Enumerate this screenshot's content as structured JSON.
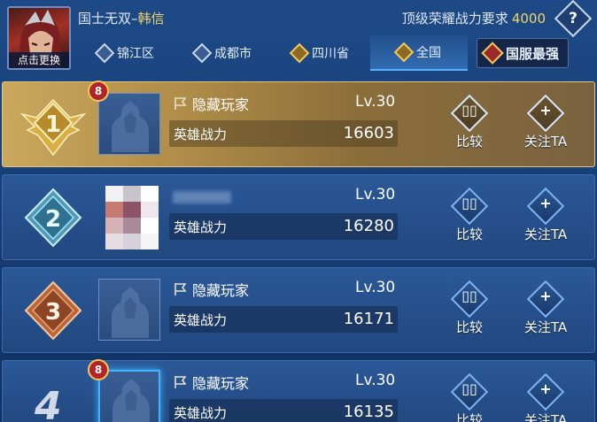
{
  "header": {
    "avatar_caption": "点击更换",
    "hero_title": "国士无双–",
    "hero_name": "韩信",
    "requirement_label": "顶级荣耀战力要求",
    "requirement_value": "4000",
    "help_label": "?"
  },
  "tabs": [
    {
      "label": "锦江区",
      "icon": "district-badge-icon"
    },
    {
      "label": "成都市",
      "icon": "city-badge-icon"
    },
    {
      "label": "四川省",
      "icon": "province-badge-icon"
    },
    {
      "label": "全国",
      "icon": "national-badge-icon",
      "active": true
    },
    {
      "label": "国服最强",
      "icon": "national-strongest-icon"
    }
  ],
  "rows": [
    {
      "rank": "1",
      "name": "隐藏玩家",
      "level": "Lv.30",
      "power_label": "英雄战力",
      "power": "16603",
      "badge_level": "8"
    },
    {
      "rank": "2",
      "name": "",
      "level": "Lv.30",
      "power_label": "英雄战力",
      "power": "16280"
    },
    {
      "rank": "3",
      "name": "隐藏玩家",
      "level": "Lv.30",
      "power_label": "英雄战力",
      "power": "16171"
    },
    {
      "rank": "4",
      "name": "隐藏玩家",
      "level": "Lv.30",
      "power_label": "英雄战力",
      "power": "16135",
      "badge_level": "8"
    }
  ],
  "actions": {
    "compare": "比较",
    "follow": "关注TA"
  },
  "colors": {
    "gold": "#f3d36b",
    "rank1": "#e7c35a",
    "rank2": "#8fd1e8",
    "rank3": "#d7814a",
    "active_tab": "#58b4ff"
  }
}
